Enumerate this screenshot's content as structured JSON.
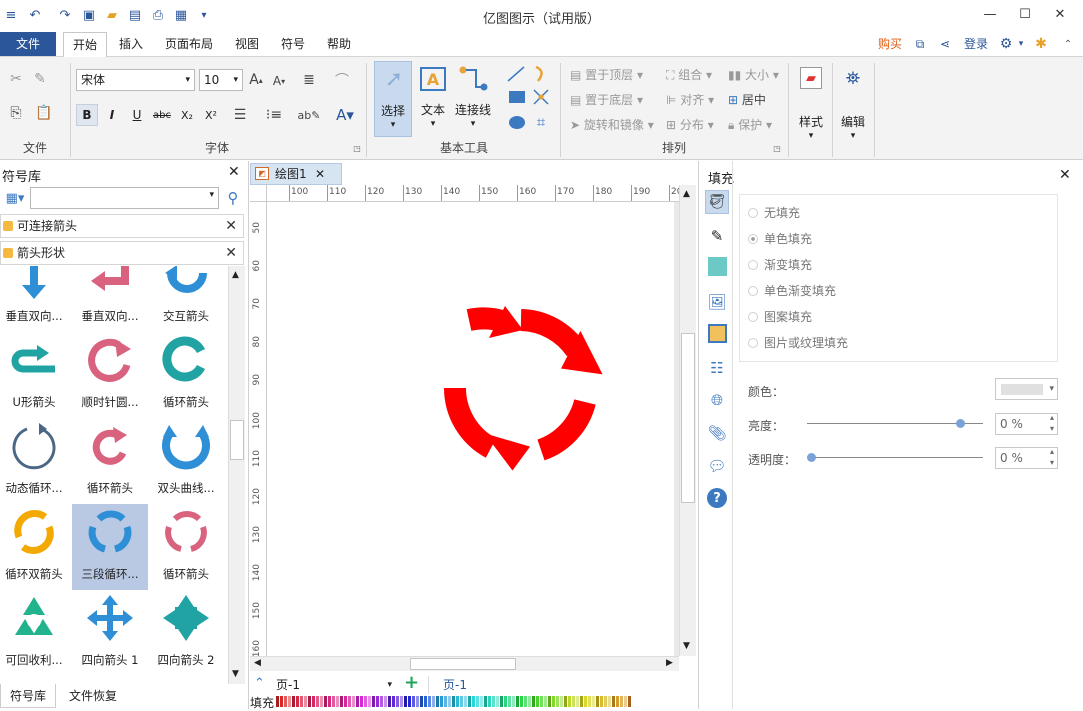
{
  "app": {
    "title": "亿图图示（试用版）"
  },
  "window": {
    "minimize": "—",
    "maximize": "☐",
    "close": "✕"
  },
  "menu": {
    "file": "文件",
    "tabs": [
      "开始",
      "插入",
      "页面布局",
      "视图",
      "符号",
      "帮助"
    ],
    "buy": "购买",
    "login": "登录"
  },
  "ribbon": {
    "group_file": "文件",
    "group_font": "字体",
    "group_basic": "基本工具",
    "group_arrange": "排列",
    "font_name": "宋体",
    "font_size": "10",
    "select": "选择",
    "text": "文本",
    "connector": "连接线",
    "bring_front": "置于顶层",
    "send_back": "置于底层",
    "rotate": "旋转和镜像",
    "group": "组合",
    "align": "对齐",
    "distribute": "分布",
    "size": "大小",
    "center": "居中",
    "protect": "保护",
    "style": "样式",
    "edit": "编辑"
  },
  "library": {
    "title": "符号库",
    "categories": [
      "可连接箭头",
      "箭头形状"
    ],
    "items": [
      {
        "label": "垂直双向...",
        "icon": "vertical-double-arrow-icon"
      },
      {
        "label": "垂直双向...",
        "icon": "vertical-double-arrow-2-icon"
      },
      {
        "label": "交互箭头",
        "icon": "interactive-arrow-icon"
      },
      {
        "label": "U形箭头",
        "icon": "u-arrow-icon"
      },
      {
        "label": "顺时针圆...",
        "icon": "clockwise-circle-arrow-icon"
      },
      {
        "label": "循环箭头",
        "icon": "loop-arrow-icon"
      },
      {
        "label": "动态循环...",
        "icon": "dynamic-loop-icon"
      },
      {
        "label": "循环箭头",
        "icon": "loop-arrow-2-icon"
      },
      {
        "label": "双头曲线...",
        "icon": "double-head-curve-icon"
      },
      {
        "label": "循环双箭头",
        "icon": "loop-double-arrow-icon"
      },
      {
        "label": "三段循环...",
        "icon": "three-segment-loop-icon"
      },
      {
        "label": "循环箭头",
        "icon": "loop-arrow-3-icon"
      },
      {
        "label": "可回收利...",
        "icon": "recycle-icon"
      },
      {
        "label": "四向箭头 1",
        "icon": "four-way-arrow-1-icon"
      },
      {
        "label": "四向箭头 2",
        "icon": "four-way-arrow-2-icon"
      }
    ],
    "bottom_tabs": [
      "符号库",
      "文件恢复"
    ]
  },
  "document": {
    "tab": "绘图1",
    "ruler_h": [
      "100",
      "110",
      "120",
      "130",
      "140",
      "150",
      "160",
      "170",
      "180",
      "190",
      "20"
    ],
    "ruler_v": [
      "50",
      "60",
      "70",
      "80",
      "90",
      "100",
      "110",
      "120",
      "130",
      "140",
      "150",
      "160"
    ],
    "page_select": "页-1",
    "page_tab": "页-1",
    "fill_label": "填充"
  },
  "fill_panel": {
    "title": "填充",
    "options": [
      "无填充",
      "单色填充",
      "渐变填充",
      "单色渐变填充",
      "图案填充",
      "图片或纹理填充"
    ],
    "selected_option": "单色填充",
    "color_label": "颜色：",
    "brightness_label": "亮度：",
    "brightness_value": "0 %",
    "brightness_level": 0.87,
    "transparency_label": "透明度：",
    "transparency_value": "0 %",
    "transparency_level": 0.0
  },
  "colors": {
    "accent": "#2b579a",
    "shape": "#ff0000",
    "lib_blue": "#2f8fd6",
    "lib_pink": "#d9627f",
    "lib_teal": "#21a3a3",
    "lib_orange": "#f4a900",
    "lib_green": "#22b28c"
  }
}
